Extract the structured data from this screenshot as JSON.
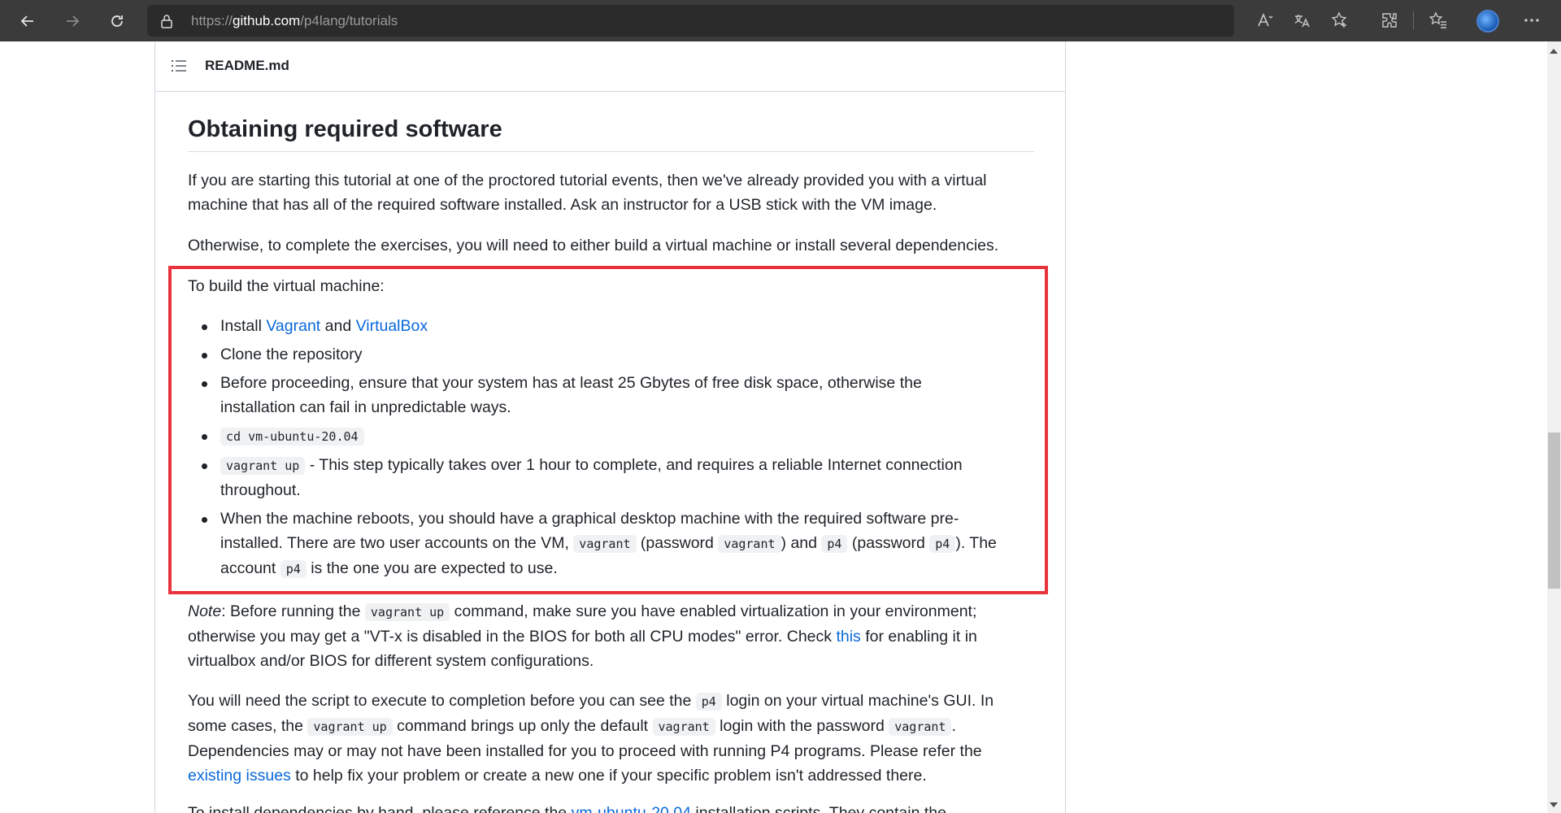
{
  "browser": {
    "url_prefix": "https://",
    "url_host": "github.com",
    "url_path": "/p4lang/tutorials",
    "icons": [
      "back-icon",
      "forward-icon",
      "refresh-icon",
      "lock-icon",
      "read-aloud-icon",
      "translate-icon",
      "add-favorite-icon",
      "extensions-icon",
      "favorites-icon",
      "profile-avatar",
      "more-icon"
    ]
  },
  "readme": {
    "filename": "README.md",
    "heading": "Obtaining required software",
    "p1": "If you are starting this tutorial at one of the proctored tutorial events, then we've already provided you with a virtual machine that has all of the required software installed. Ask an instructor for a USB stick with the VM image.",
    "p2": "Otherwise, to complete the exercises, you will need to either build a virtual machine or install several dependencies.",
    "p3": "To build the virtual machine:",
    "bullets": {
      "b1_pre": "Install ",
      "b1_link1": "Vagrant",
      "b1_mid": " and ",
      "b1_link2": "VirtualBox",
      "b2": "Clone the repository",
      "b3": "Before proceeding, ensure that your system has at least 25 Gbytes of free disk space, otherwise the installation can fail in unpredictable ways.",
      "b4_code": "cd vm-ubuntu-20.04",
      "b5_code": "vagrant up",
      "b5_text": " - This step typically takes over 1 hour to complete, and requires a reliable Internet connection throughout.",
      "b6_t1": "When the machine reboots, you should have a graphical desktop machine with the required software pre-installed. There are two user accounts on the VM, ",
      "b6_c1": "vagrant",
      "b6_t2": " (password ",
      "b6_c2": "vagrant",
      "b6_t3": ") and ",
      "b6_c3": "p4",
      "b6_t4": " (password ",
      "b6_c4": "p4",
      "b6_t5": "). The account ",
      "b6_c5": "p4",
      "b6_t6": " is the one you are expected to use."
    },
    "note": {
      "label": "Note",
      "t1": ": Before running the ",
      "c1": "vagrant up",
      "t2": " command, make sure you have enabled virtualization in your environment; otherwise you may get a \"VT-x is disabled in the BIOS for both all CPU modes\" error. Check ",
      "link": "this",
      "t3": " for enabling it in virtualbox and/or BIOS for different system configurations."
    },
    "p5": {
      "t1": "You will need the script to execute to completion before you can see the ",
      "c1": "p4",
      "t2": " login on your virtual machine's GUI. In some cases, the ",
      "c2": "vagrant up",
      "t3": " command brings up only the default ",
      "c3": "vagrant",
      "t4": " login with the password ",
      "c4": "vagrant",
      "t5": ". Dependencies may or may not have been installed for you to proceed with running P4 programs. Please refer the ",
      "link": "existing issues",
      "t6": " to help fix your problem or create a new one if your specific problem isn't addressed there."
    },
    "p6": {
      "t1": "To install dependencies by hand, please reference the ",
      "link": "vm-ubuntu-20.04",
      "t2": " installation scripts. They contain the"
    }
  },
  "colors": {
    "highlight_border": "#e8333c",
    "link": "#0969da",
    "chrome_bg": "#3b3b3b"
  }
}
